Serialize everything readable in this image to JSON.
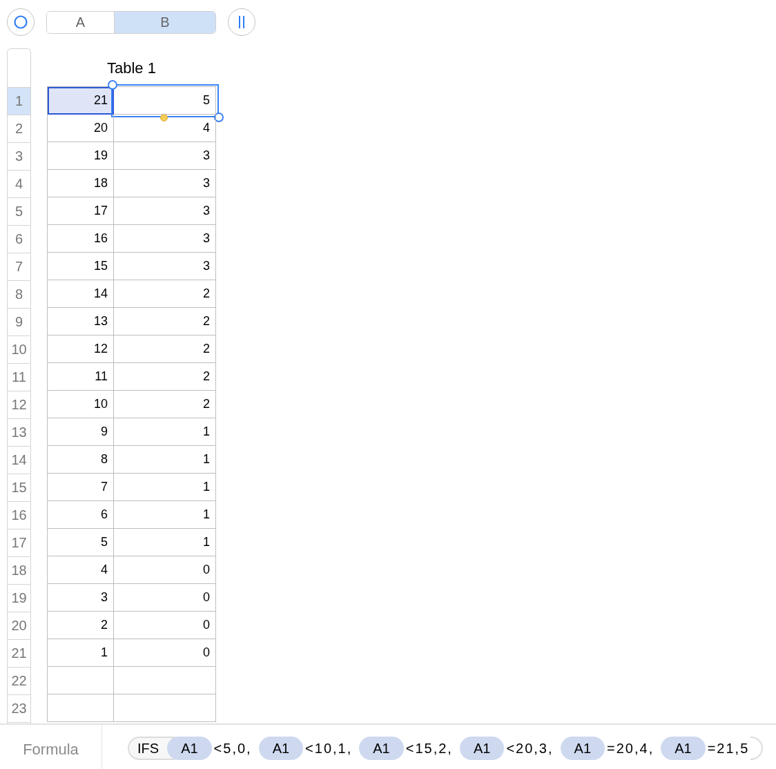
{
  "toolbar": {
    "segments": [
      {
        "label": "A",
        "selected": false
      },
      {
        "label": "B",
        "selected": true
      }
    ]
  },
  "table": {
    "title": "Table 1",
    "rows": [
      {
        "header": "1",
        "selected": true,
        "cells": [
          {
            "value": "21",
            "referenced": true,
            "editing": false
          },
          {
            "value": "5",
            "referenced": false,
            "editing": true
          }
        ]
      },
      {
        "header": "2",
        "selected": false,
        "cells": [
          {
            "value": "20",
            "referenced": false,
            "editing": false
          },
          {
            "value": "4",
            "referenced": false,
            "editing": false
          }
        ]
      },
      {
        "header": "3",
        "selected": false,
        "cells": [
          {
            "value": "19",
            "referenced": false,
            "editing": false
          },
          {
            "value": "3",
            "referenced": false,
            "editing": false
          }
        ]
      },
      {
        "header": "4",
        "selected": false,
        "cells": [
          {
            "value": "18",
            "referenced": false,
            "editing": false
          },
          {
            "value": "3",
            "referenced": false,
            "editing": false
          }
        ]
      },
      {
        "header": "5",
        "selected": false,
        "cells": [
          {
            "value": "17",
            "referenced": false,
            "editing": false
          },
          {
            "value": "3",
            "referenced": false,
            "editing": false
          }
        ]
      },
      {
        "header": "6",
        "selected": false,
        "cells": [
          {
            "value": "16",
            "referenced": false,
            "editing": false
          },
          {
            "value": "3",
            "referenced": false,
            "editing": false
          }
        ]
      },
      {
        "header": "7",
        "selected": false,
        "cells": [
          {
            "value": "15",
            "referenced": false,
            "editing": false
          },
          {
            "value": "3",
            "referenced": false,
            "editing": false
          }
        ]
      },
      {
        "header": "8",
        "selected": false,
        "cells": [
          {
            "value": "14",
            "referenced": false,
            "editing": false
          },
          {
            "value": "2",
            "referenced": false,
            "editing": false
          }
        ]
      },
      {
        "header": "9",
        "selected": false,
        "cells": [
          {
            "value": "13",
            "referenced": false,
            "editing": false
          },
          {
            "value": "2",
            "referenced": false,
            "editing": false
          }
        ]
      },
      {
        "header": "10",
        "selected": false,
        "cells": [
          {
            "value": "12",
            "referenced": false,
            "editing": false
          },
          {
            "value": "2",
            "referenced": false,
            "editing": false
          }
        ]
      },
      {
        "header": "11",
        "selected": false,
        "cells": [
          {
            "value": "11",
            "referenced": false,
            "editing": false
          },
          {
            "value": "2",
            "referenced": false,
            "editing": false
          }
        ]
      },
      {
        "header": "12",
        "selected": false,
        "cells": [
          {
            "value": "10",
            "referenced": false,
            "editing": false
          },
          {
            "value": "2",
            "referenced": false,
            "editing": false
          }
        ]
      },
      {
        "header": "13",
        "selected": false,
        "cells": [
          {
            "value": "9",
            "referenced": false,
            "editing": false
          },
          {
            "value": "1",
            "referenced": false,
            "editing": false
          }
        ]
      },
      {
        "header": "14",
        "selected": false,
        "cells": [
          {
            "value": "8",
            "referenced": false,
            "editing": false
          },
          {
            "value": "1",
            "referenced": false,
            "editing": false
          }
        ]
      },
      {
        "header": "15",
        "selected": false,
        "cells": [
          {
            "value": "7",
            "referenced": false,
            "editing": false
          },
          {
            "value": "1",
            "referenced": false,
            "editing": false
          }
        ]
      },
      {
        "header": "16",
        "selected": false,
        "cells": [
          {
            "value": "6",
            "referenced": false,
            "editing": false
          },
          {
            "value": "1",
            "referenced": false,
            "editing": false
          }
        ]
      },
      {
        "header": "17",
        "selected": false,
        "cells": [
          {
            "value": "5",
            "referenced": false,
            "editing": false
          },
          {
            "value": "1",
            "referenced": false,
            "editing": false
          }
        ]
      },
      {
        "header": "18",
        "selected": false,
        "cells": [
          {
            "value": "4",
            "referenced": false,
            "editing": false
          },
          {
            "value": "0",
            "referenced": false,
            "editing": false
          }
        ]
      },
      {
        "header": "19",
        "selected": false,
        "cells": [
          {
            "value": "3",
            "referenced": false,
            "editing": false
          },
          {
            "value": "0",
            "referenced": false,
            "editing": false
          }
        ]
      },
      {
        "header": "20",
        "selected": false,
        "cells": [
          {
            "value": "2",
            "referenced": false,
            "editing": false
          },
          {
            "value": "0",
            "referenced": false,
            "editing": false
          }
        ]
      },
      {
        "header": "21",
        "selected": false,
        "cells": [
          {
            "value": "1",
            "referenced": false,
            "editing": false
          },
          {
            "value": "0",
            "referenced": false,
            "editing": false
          }
        ]
      },
      {
        "header": "22",
        "selected": false
      },
      {
        "header": "23",
        "selected": false
      }
    ]
  },
  "formula_bar": {
    "label": "Formula",
    "tokens": [
      {
        "kind": "function",
        "text": "IFS"
      },
      {
        "kind": "reference",
        "text": "A1"
      },
      {
        "kind": "operator",
        "text": "<5,0,"
      },
      {
        "kind": "reference",
        "text": "A1"
      },
      {
        "kind": "operator",
        "text": "<10,1,"
      },
      {
        "kind": "reference",
        "text": "A1"
      },
      {
        "kind": "operator",
        "text": "<15,2,"
      },
      {
        "kind": "reference",
        "text": "A1"
      },
      {
        "kind": "operator",
        "text": "<20,3,"
      },
      {
        "kind": "reference",
        "text": "A1"
      },
      {
        "kind": "operator",
        "text": "=20,4,"
      },
      {
        "kind": "reference",
        "text": "A1"
      },
      {
        "kind": "operator",
        "text": "=21,5"
      },
      {
        "kind": "close"
      }
    ]
  }
}
